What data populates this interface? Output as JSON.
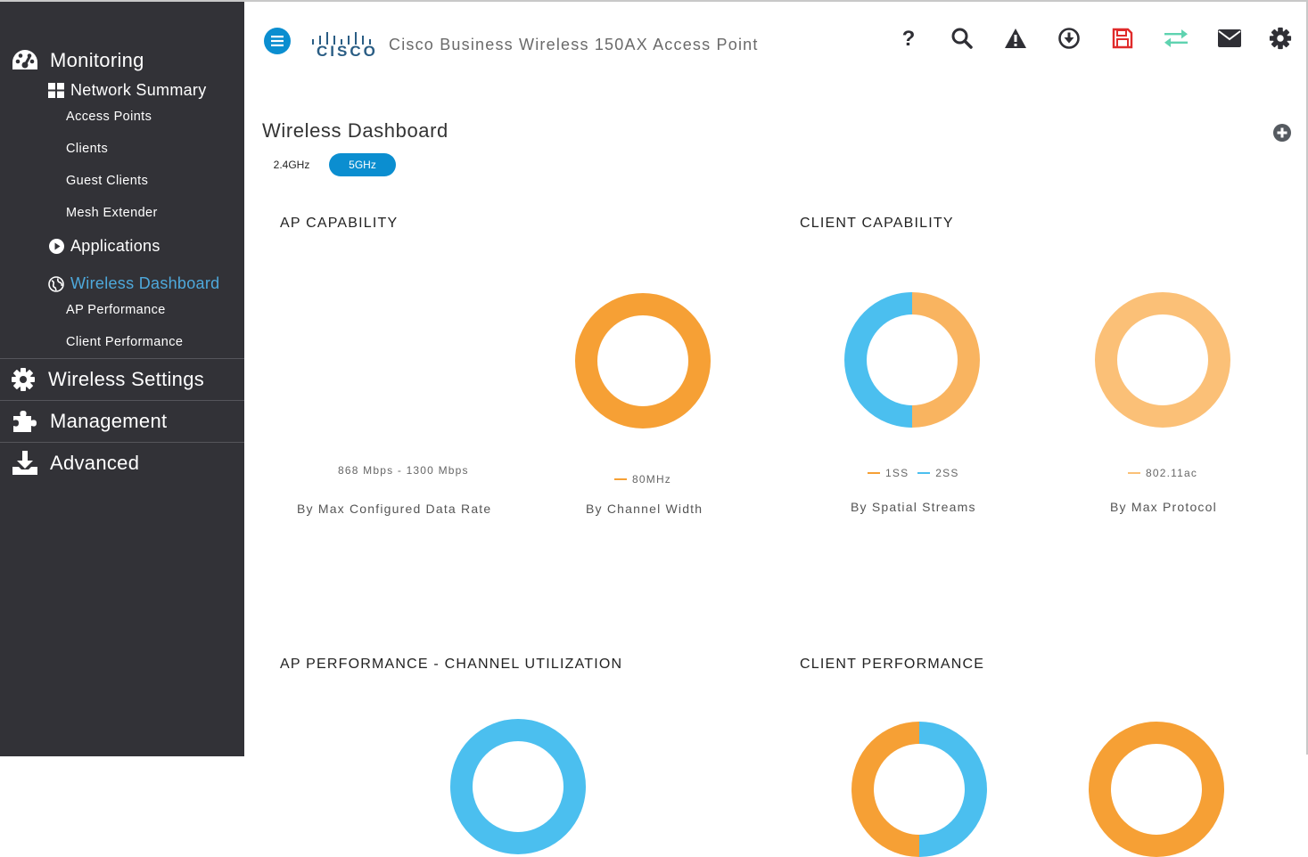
{
  "sidebar": {
    "monitoring": {
      "label": "Monitoring",
      "network_summary": {
        "label": "Network Summary",
        "items": [
          {
            "label": "Access Points"
          },
          {
            "label": "Clients"
          },
          {
            "label": "Guest Clients"
          },
          {
            "label": "Mesh Extender"
          }
        ]
      },
      "applications": {
        "label": "Applications"
      },
      "wireless_dashboard": {
        "label": "Wireless Dashboard",
        "items": [
          {
            "label": "AP Performance"
          },
          {
            "label": "Client Performance"
          }
        ]
      }
    },
    "wireless_settings": {
      "label": "Wireless Settings"
    },
    "management": {
      "label": "Management"
    },
    "advanced": {
      "label": "Advanced"
    }
  },
  "header": {
    "logo_text": "CISCO",
    "title": "Cisco Business Wireless 150AX Access Point",
    "toolbar_icons": [
      "help-icon",
      "search-icon",
      "alert-icon",
      "download-icon",
      "save-icon",
      "transfer-icon",
      "mail-icon",
      "gear-icon"
    ],
    "save_icon_color": "#e02b2b",
    "transfer_icon_color": "#5fd3b0"
  },
  "main": {
    "title": "Wireless Dashboard",
    "bands": [
      {
        "label": "2.4GHz",
        "selected": false
      },
      {
        "label": "5GHz",
        "selected": true
      }
    ],
    "sections": {
      "ap_capability": "AP CAPABILITY",
      "client_capability": "CLIENT CAPABILITY",
      "ap_performance": "AP PERFORMANCE - CHANNEL UTILIZATION",
      "client_performance": "CLIENT PERFORMANCE"
    }
  },
  "chart_data": [
    {
      "type": "pie",
      "title": "By Max Configured Data Rate",
      "caption": "By Max Configured Data Rate",
      "slices": [],
      "legend": [
        "868 Mbps - 1300 Mbps"
      ]
    },
    {
      "type": "pie",
      "title": "By Channel Width",
      "caption": "By Channel Width",
      "slices": [
        {
          "label": "80MHz",
          "value": 100,
          "color": "#f6a035"
        }
      ]
    },
    {
      "type": "pie",
      "title": "By Spatial Streams",
      "caption": "By Spatial Streams",
      "slices": [
        {
          "label": "1SS",
          "value": 50,
          "color": "#f9b460"
        },
        {
          "label": "2SS",
          "value": 50,
          "color": "#4bbfef"
        }
      ]
    },
    {
      "type": "pie",
      "title": "By Max Protocol",
      "caption": "By Max Protocol",
      "slices": [
        {
          "label": "802.11ac",
          "value": 100,
          "color": "#fbc077"
        }
      ]
    },
    {
      "type": "pie",
      "title": "AP PERFORMANCE - CHANNEL UTILIZATION",
      "slices": [
        {
          "label": "",
          "value": 100,
          "color": "#4bbfef"
        }
      ]
    },
    {
      "type": "pie",
      "title": "CLIENT PERFORMANCE",
      "slices": [
        {
          "label": "",
          "value": 50,
          "color": "#4bbfef"
        },
        {
          "label": "",
          "value": 50,
          "color": "#f6a035"
        }
      ]
    },
    {
      "type": "pie",
      "title": "CLIENT PERFORMANCE",
      "slices": [
        {
          "label": "",
          "value": 100,
          "color": "#f6a035"
        }
      ]
    }
  ],
  "captions": {
    "data_rate_legend": "868 Mbps - 1300 Mbps",
    "data_rate": "By Max Configured Data Rate",
    "channel_width_legend": "80MHz",
    "channel_width": "By Channel Width",
    "ss_legend_1": "1SS",
    "ss_legend_2": "2SS",
    "spatial_streams": "By Spatial Streams",
    "protocol_legend": "802.11ac",
    "protocol": "By Max Protocol"
  }
}
